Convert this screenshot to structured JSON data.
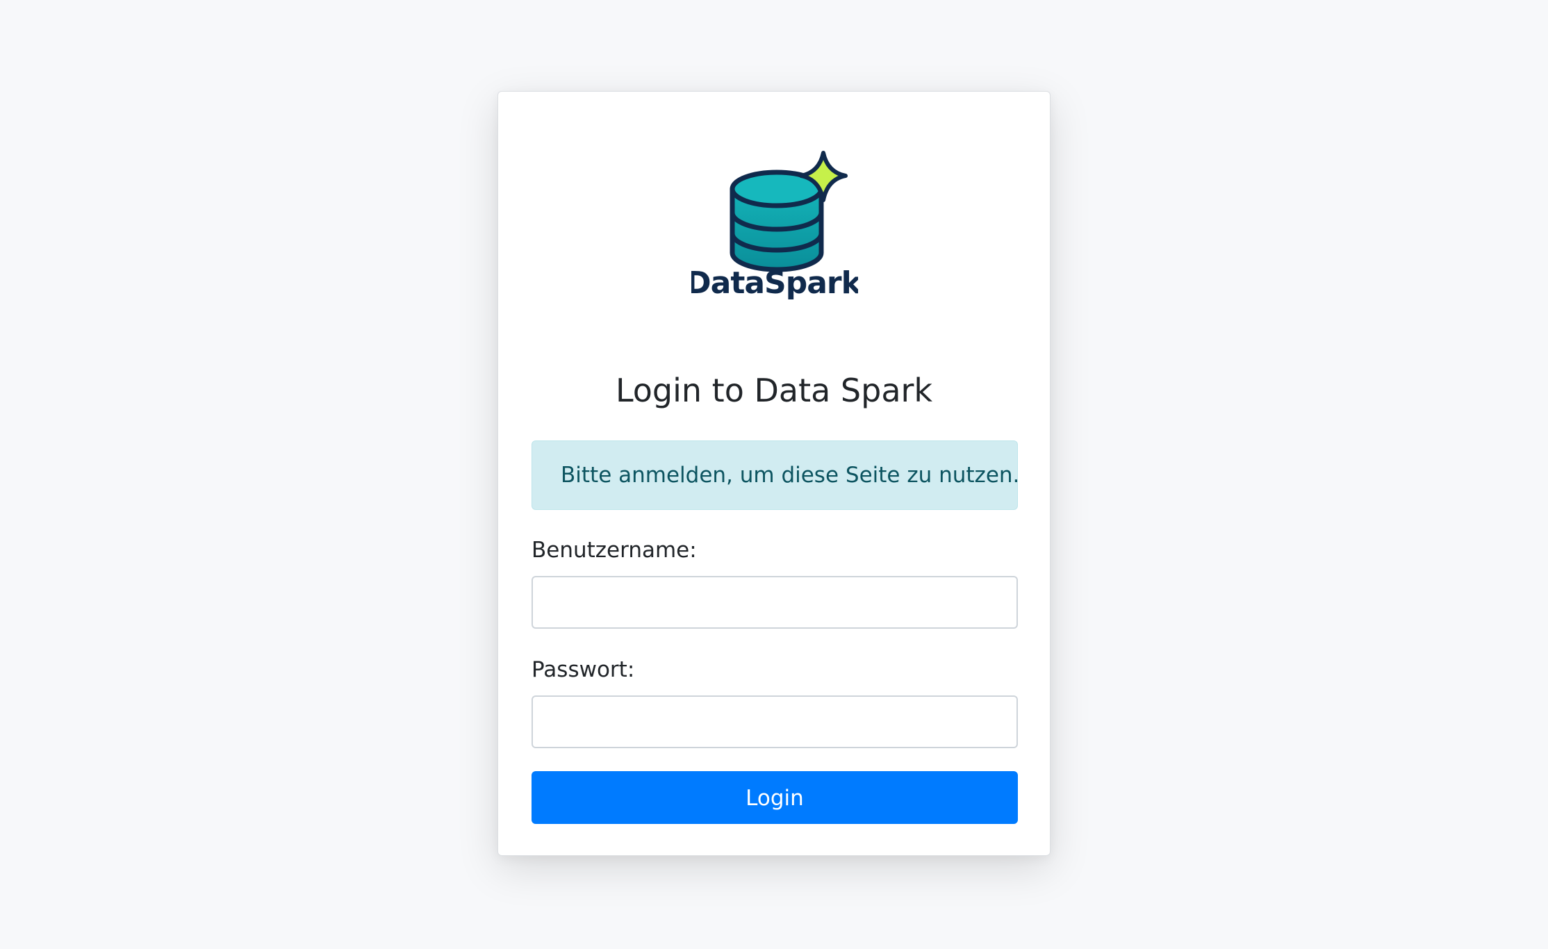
{
  "logo": {
    "brand_text": "DataSpark",
    "icon": "database-sparkle-icon",
    "colors": {
      "navy": "#102a4c",
      "teal_top": "#14b3b8",
      "teal_bottom": "#0a8e99",
      "spark": "#c6f04a"
    }
  },
  "login": {
    "title": "Login to Data Spark",
    "info_message": "Bitte anmelden, um diese Seite zu nutzen.",
    "username_label": "Benutzername:",
    "username_value": "",
    "password_label": "Passwort:",
    "password_value": "",
    "submit_label": "Login"
  },
  "colors": {
    "background": "#f7f8fa",
    "alert_background": "#d1ecf1",
    "alert_text": "#0c5460",
    "button_primary": "#007bff"
  }
}
